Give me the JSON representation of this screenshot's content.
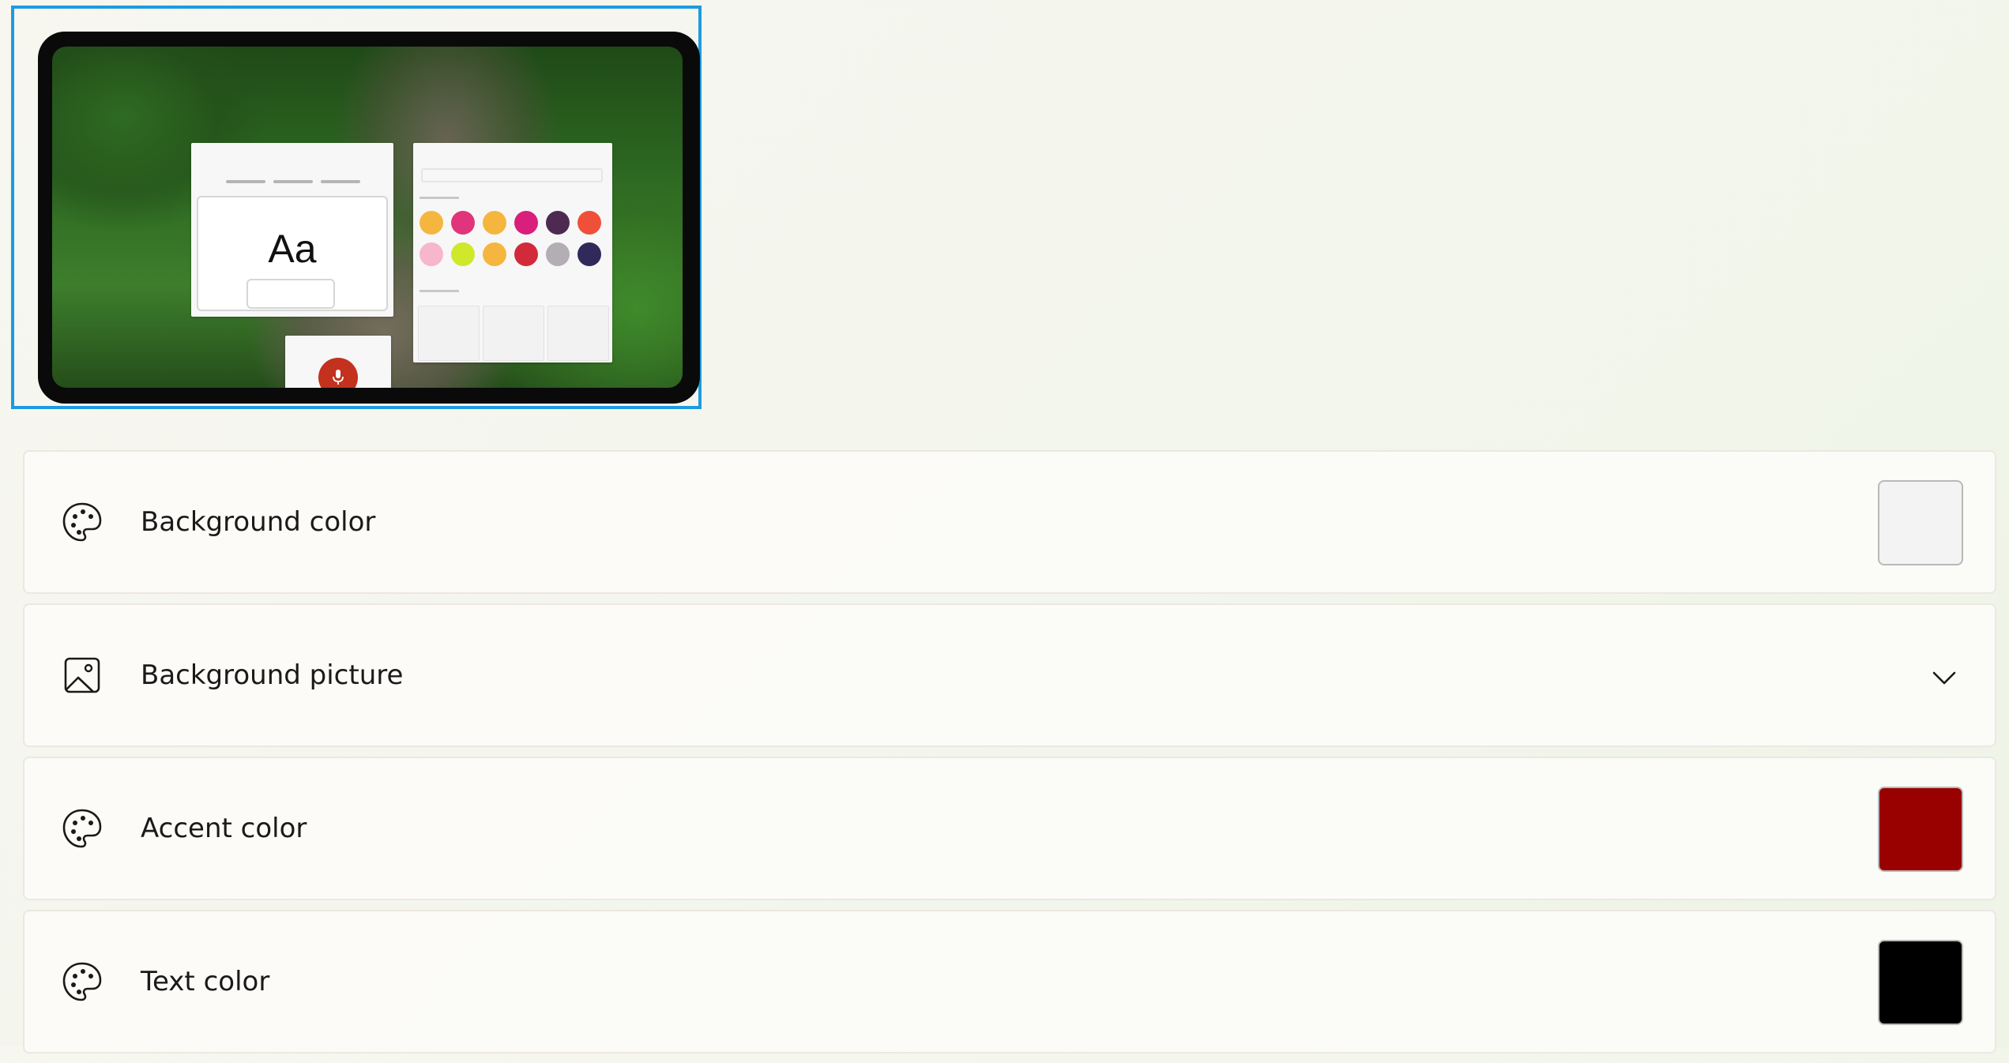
{
  "preview": {
    "sample_text": "Aa",
    "palette": [
      "#f5b63f",
      "#e0357a",
      "#f5b63f",
      "#d91e7c",
      "#4e2a52",
      "#f0503a",
      "#f7b6cc",
      "#cfe82a",
      "#f5b63f",
      "#d22a3a",
      "#b3aeb4",
      "#2f2a5a"
    ],
    "accent": "#c2321f"
  },
  "settings": [
    {
      "label": "Background color",
      "icon": "palette-icon",
      "control": "swatch",
      "color": "#f3f3f3"
    },
    {
      "label": "Background picture",
      "icon": "picture-icon",
      "control": "chevron"
    },
    {
      "label": "Accent color",
      "icon": "palette-icon",
      "control": "swatch",
      "color": "#990000"
    },
    {
      "label": "Text color",
      "icon": "palette-icon",
      "control": "swatch",
      "color": "#000000"
    }
  ]
}
